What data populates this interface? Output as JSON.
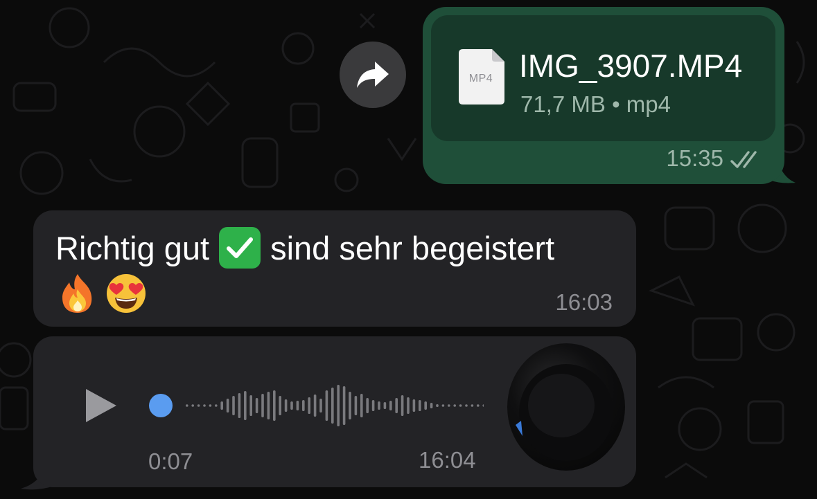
{
  "file_message": {
    "icon_label": "MP4",
    "file_name": "IMG_3907.MP4",
    "file_meta": "71,7 MB • mp4",
    "time": "15:35",
    "status_icon": "double-check-icon"
  },
  "forward_button": {
    "icon": "forward-arrow-icon"
  },
  "text_message": {
    "text_before_emoji": "Richtig gut",
    "inline_emoji": "✅",
    "text_after_emoji": "sind sehr begeistert",
    "emojis": [
      "🔥",
      "😍"
    ],
    "time": "16:03"
  },
  "voice_message": {
    "duration": "0:07",
    "time": "16:04",
    "progress": 0,
    "play_icon": "play-icon"
  },
  "colors": {
    "background": "#0b0b0b",
    "outgoing_bubble": "#1f4f39",
    "outgoing_card": "#17392a",
    "incoming_bubble": "#232326",
    "accent_blue": "#5a9cf0",
    "check_green": "#2eb14a"
  }
}
